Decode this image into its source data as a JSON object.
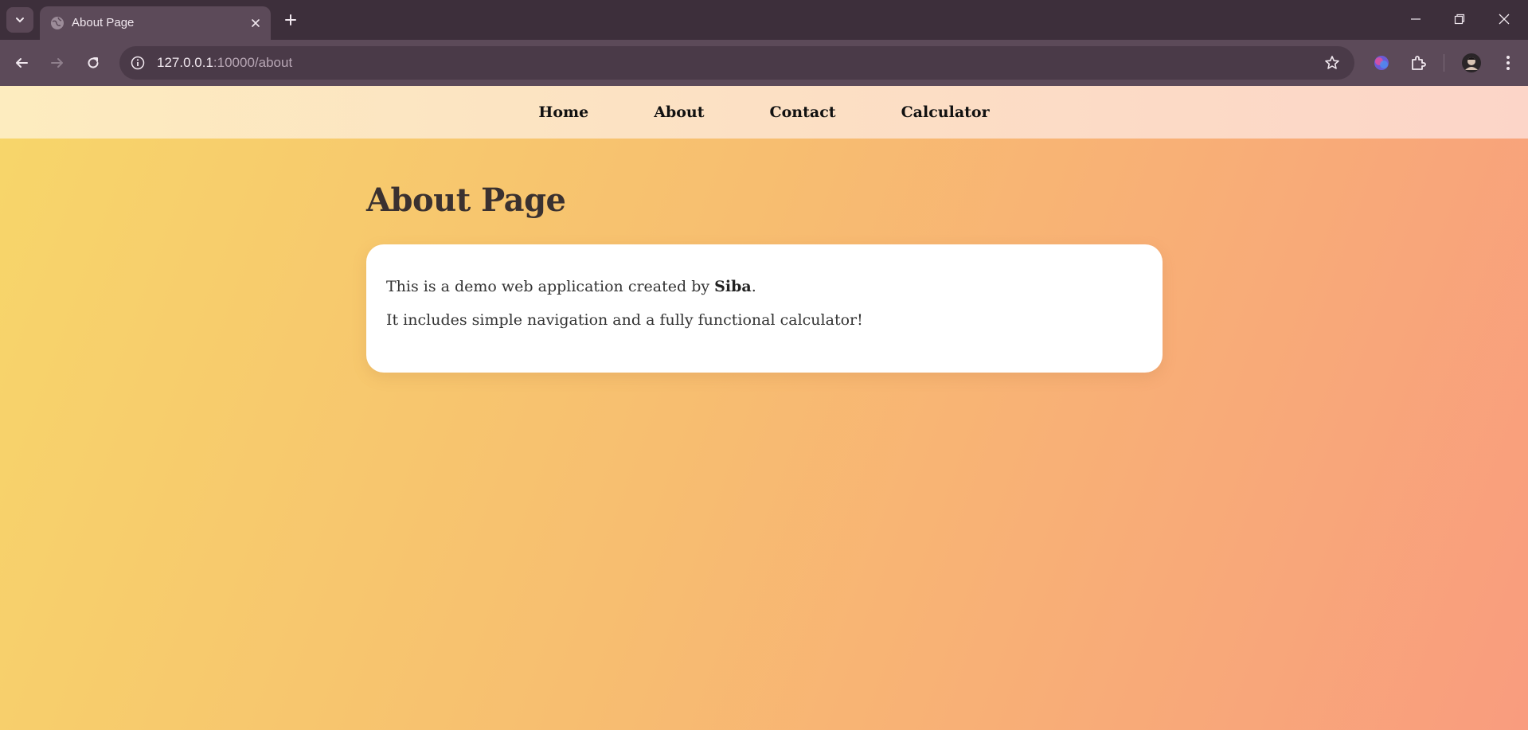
{
  "browser": {
    "tab_title": "About Page",
    "url_host": "127.0.0.1",
    "url_rest": ":10000/about"
  },
  "nav": {
    "links": [
      "Home",
      "About",
      "Contact",
      "Calculator"
    ]
  },
  "page": {
    "title": "About Page",
    "para1_prefix": "This is a demo web application created by ",
    "para1_author": "Siba",
    "para1_suffix": ".",
    "para2": "It includes simple navigation and a fully functional calculator!"
  },
  "colors": {
    "chrome_bg": "#3d2f3b",
    "toolbar_bg": "#5c4a59",
    "gradient_start": "#f7d66a",
    "gradient_end": "#f99c7e",
    "card_bg": "#ffffff"
  },
  "icons": {
    "tab_search": "chevron-down-icon",
    "favicon": "globe-icon",
    "close": "close-icon",
    "new_tab": "plus-icon",
    "back": "arrow-left-icon",
    "forward": "arrow-right-icon",
    "reload": "reload-icon",
    "site_info": "info-icon",
    "bookmark": "star-icon",
    "ai": "gemini-icon",
    "extensions": "puzzle-icon",
    "profile": "avatar",
    "menu": "kebab-menu-icon"
  }
}
